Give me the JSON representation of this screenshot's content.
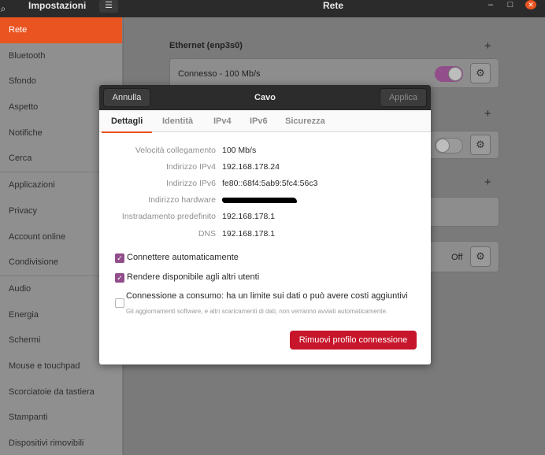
{
  "header": {
    "sidebar_title": "Impostazioni",
    "main_title": "Rete",
    "menu_glyph": "☰",
    "search_glyph": "⌕"
  },
  "sidebar": {
    "items": [
      {
        "label": "Rete",
        "icon": "network-icon"
      },
      {
        "label": "Bluetooth",
        "icon": "bluetooth-icon"
      },
      {
        "label": "Sfondo",
        "icon": "background-icon"
      },
      {
        "label": "Aspetto",
        "icon": "appearance-icon"
      },
      {
        "label": "Notifiche",
        "icon": "notifications-icon"
      },
      {
        "label": "Cerca",
        "icon": "search-icon"
      },
      {
        "label": "Applicazioni",
        "icon": "applications-icon"
      },
      {
        "label": "Privacy",
        "icon": "privacy-icon"
      },
      {
        "label": "Account online",
        "icon": "online-accounts-icon"
      },
      {
        "label": "Condivisione",
        "icon": "sharing-icon"
      },
      {
        "label": "Audio",
        "icon": "audio-icon"
      },
      {
        "label": "Energia",
        "icon": "power-icon"
      },
      {
        "label": "Schermi",
        "icon": "displays-icon"
      },
      {
        "label": "Mouse e touchpad",
        "icon": "mouse-icon"
      },
      {
        "label": "Scorciatoie da tastiera",
        "icon": "keyboard-icon"
      },
      {
        "label": "Stampanti",
        "icon": "printer-icon"
      },
      {
        "label": "Dispositivi rimovibili",
        "icon": "removable-devices-icon"
      }
    ]
  },
  "main": {
    "ethernet_title": "Ethernet (enp3s0)",
    "ethernet_status": "Connesso - 100 Mb/s",
    "off_label": "Off"
  },
  "dialog": {
    "title": "Cavo",
    "cancel_label": "Annulla",
    "apply_label": "Applica",
    "tabs": [
      "Dettagli",
      "Identità",
      "IPv4",
      "IPv6",
      "Sicurezza"
    ],
    "details": [
      {
        "label": "Velocità collegamento",
        "value": "100 Mb/s"
      },
      {
        "label": "Indirizzo IPv4",
        "value": "192.168.178.24"
      },
      {
        "label": "Indirizzo IPv6",
        "value": "fe80::68f4:5ab9:5fc4:56c3"
      },
      {
        "label": "Indirizzo hardware",
        "value": ""
      },
      {
        "label": "Instradamento predefinito",
        "value": "192.168.178.1"
      },
      {
        "label": "DNS",
        "value": "192.168.178.1"
      }
    ],
    "auto_connect_label": "Connettere automaticamente",
    "share_label": "Rendere disponibile agli altri utenti",
    "metered_label": "Connessione a consumo: ha un limite sui dati o può avere costi aggiuntivi",
    "metered_sub": "Gli aggiornamenti software, e altri scaricamenti di dati, non verranno avviati automaticamente.",
    "remove_label": "Rimuovi profilo connessione"
  },
  "colors": {
    "accent": "#e95420",
    "checkbox": "#924d8b",
    "danger": "#c7162b",
    "toggle_on": "#924d8b"
  }
}
